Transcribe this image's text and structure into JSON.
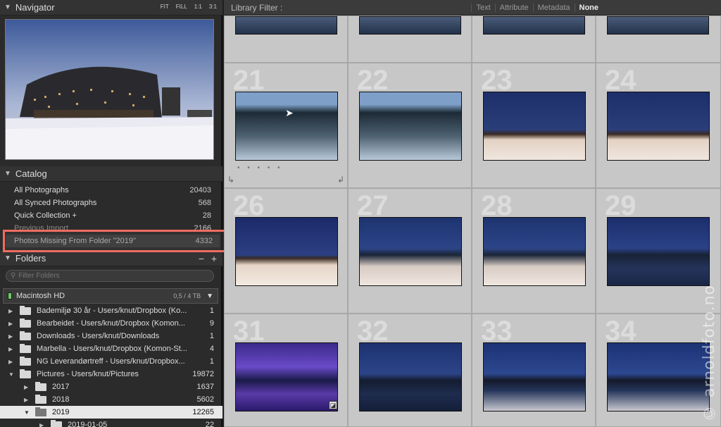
{
  "navigator": {
    "title": "Navigator",
    "options": [
      "FIT",
      "FILL",
      "1:1",
      "3:1"
    ]
  },
  "catalog": {
    "title": "Catalog",
    "items": [
      {
        "label": "All Photographs",
        "count": "20403"
      },
      {
        "label": "All Synced Photographs",
        "count": "568"
      },
      {
        "label": "Quick Collection +",
        "count": "28"
      },
      {
        "label": "Previous Import",
        "count": "2166"
      }
    ],
    "highlighted": {
      "label": "Photos Missing From Folder \"2019\"",
      "count": "4332"
    }
  },
  "folders": {
    "title": "Folders",
    "filter_placeholder": "Filter Folders",
    "volume": {
      "name": "Macintosh HD",
      "size": "0,5 / 4 TB"
    },
    "items": [
      {
        "name": "Bademiljø 30 år - Users/knut/Dropbox (Ko...",
        "count": "1"
      },
      {
        "name": "Bearbeidet - Users/knut/Dropbox (Komon...",
        "count": "9"
      },
      {
        "name": "Downloads - Users/knut/Downloads",
        "count": "1"
      },
      {
        "name": "Marbella - Users/knut/Dropbox (Komon-St...",
        "count": "4"
      },
      {
        "name": "NG Leverandørtreff - Users/knut/Dropbox...",
        "count": "1"
      },
      {
        "name": "Pictures - Users/knut/Pictures",
        "count": "19872"
      },
      {
        "name": "2017",
        "count": "1637"
      },
      {
        "name": "2018",
        "count": "5602"
      },
      {
        "name": "2019",
        "count": "12265"
      },
      {
        "name": "2019-01-05",
        "count": "22"
      }
    ]
  },
  "library_filter": {
    "label": "Library Filter :",
    "options": [
      "Text",
      "Attribute",
      "Metadata",
      "None"
    ],
    "active": "None"
  },
  "grid": {
    "numbers": [
      "21",
      "22",
      "23",
      "24",
      "26",
      "27",
      "28",
      "29",
      "31",
      "32",
      "33",
      "34"
    ]
  },
  "watermark": "© arnoldfoto.no",
  "colors": {
    "highlight": "#ee6d61",
    "selected_row": "#e8e8e8"
  }
}
